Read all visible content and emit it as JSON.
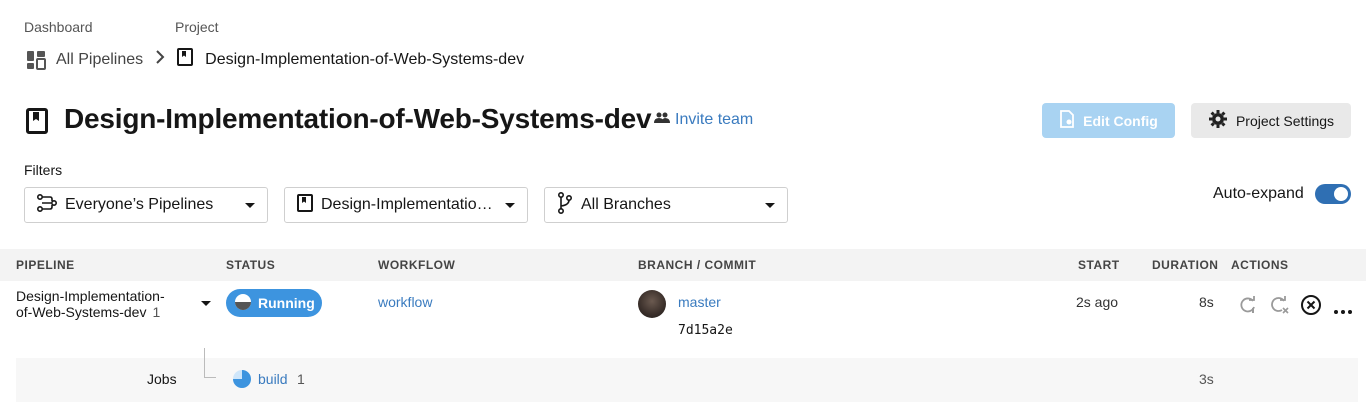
{
  "breadcrumb": {
    "dashboard_label": "Dashboard",
    "project_label": "Project",
    "all_pipelines": "All Pipelines",
    "project_name": "Design-Implementation-of-Web-Systems-dev"
  },
  "header": {
    "title": "Design-Implementation-of-Web-Systems-dev",
    "invite": "Invite team",
    "edit_config": "Edit Config",
    "project_settings": "Project Settings"
  },
  "filters": {
    "label": "Filters",
    "pipelines": "Everyone’s Pipelines",
    "project": "Design-Implementatio…",
    "branches": "All Branches",
    "auto_expand": "Auto-expand",
    "auto_expand_on": true
  },
  "table": {
    "headers": {
      "pipeline": "PIPELINE",
      "status": "STATUS",
      "workflow": "WORKFLOW",
      "branch": "BRANCH / COMMIT",
      "start": "START",
      "duration": "DURATION",
      "actions": "ACTIONS"
    },
    "row": {
      "pipeline_name_1": "Design-Implementation-",
      "pipeline_name_2": "of-Web-Systems-dev",
      "pipeline_number": "1",
      "status": "Running",
      "workflow": "workflow",
      "branch": "master",
      "commit": "7d15a2e",
      "start": "2s ago",
      "duration": "8s"
    },
    "jobs": {
      "label": "Jobs",
      "job_name": "build",
      "job_number": "1",
      "job_duration": "3s"
    }
  },
  "colors": {
    "accent": "#3a7bbf",
    "running": "#3d94df",
    "edit_disabled": "#a9d3f2"
  }
}
